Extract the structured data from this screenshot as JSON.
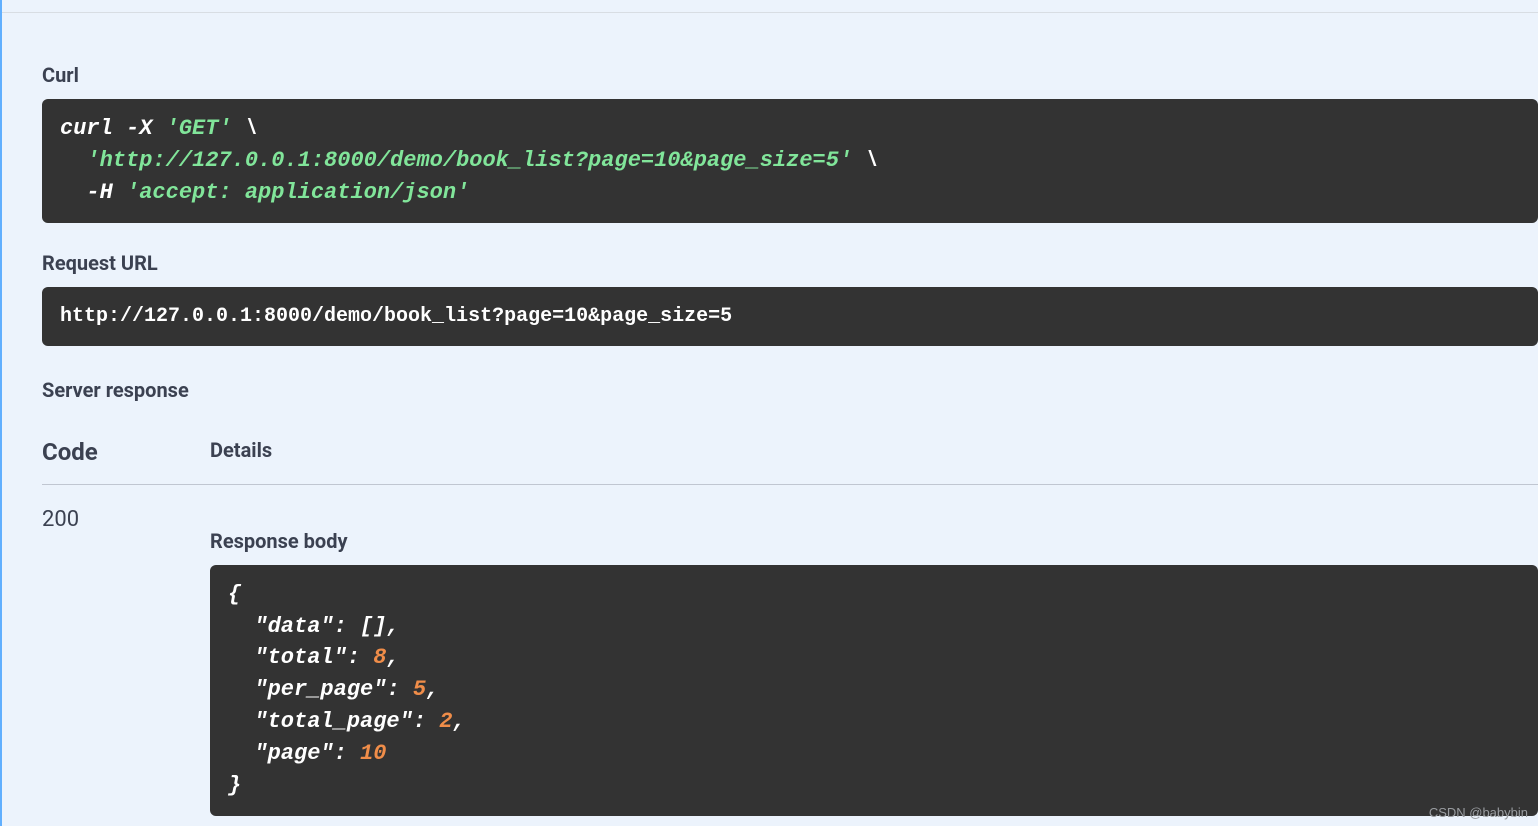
{
  "labels": {
    "curl": "Curl",
    "request_url": "Request URL",
    "server_response": "Server response",
    "code_header": "Code",
    "details_header": "Details",
    "response_body": "Response body"
  },
  "curl": {
    "cmd_prefix": "curl -X ",
    "method_quote": "'GET'",
    "line1_suffix": " \\",
    "url_quoted": "'http://127.0.0.1:8000/demo/book_list?page=10&page_size=5'",
    "line2_suffix": " \\",
    "header_flag": "-H ",
    "header_quoted": "'accept: application/json'"
  },
  "request_url": "http://127.0.0.1:8000/demo/book_list?page=10&page_size=5",
  "response": {
    "code": "200",
    "body": {
      "data_key": "\"data\"",
      "data_value": "[]",
      "total_key": "\"total\"",
      "total_value": "8",
      "per_page_key": "\"per_page\"",
      "per_page_value": "5",
      "total_page_key": "\"total_page\"",
      "total_page_value": "2",
      "page_key": "\"page\"",
      "page_value": "10"
    }
  },
  "watermark": "CSDN @babybin"
}
